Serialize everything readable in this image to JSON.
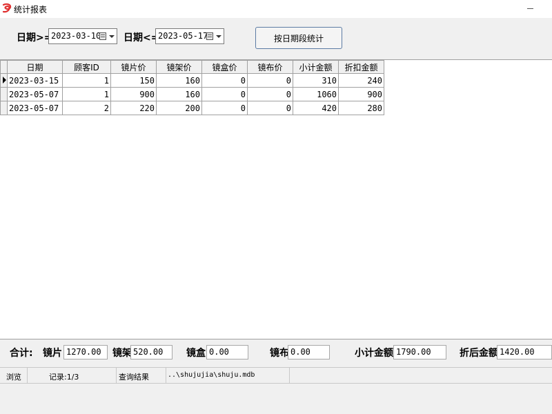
{
  "window": {
    "title": "统计报表"
  },
  "filter": {
    "date_from_label": "日期>=",
    "date_from_value": "2023-03-10",
    "date_to_label": "日期<=",
    "date_to_value": "2023-05-17",
    "stat_button_label": "按日期段统计"
  },
  "grid": {
    "columns": [
      "日期",
      "顾客ID",
      "镜片价",
      "镜架价",
      "镜盒价",
      "镜布价",
      "小计金额",
      "折扣金额"
    ],
    "rows": [
      [
        "2023-03-15",
        "1",
        "150",
        "160",
        "0",
        "0",
        "310",
        "240"
      ],
      [
        "2023-05-07",
        "1",
        "900",
        "160",
        "0",
        "0",
        "1060",
        "900"
      ],
      [
        "2023-05-07",
        "2",
        "220",
        "200",
        "0",
        "0",
        "420",
        "280"
      ]
    ],
    "current_row": 0
  },
  "totals": {
    "heading": "合计:",
    "lens_label": "镜片",
    "lens_value": "1270.00",
    "frame_label": "镜架",
    "frame_value": "520.00",
    "case_label": "镜盒",
    "case_value": "0.00",
    "cloth_label": "镜布",
    "cloth_value": "0.00",
    "subtotal_label": "小计金额",
    "subtotal_value": "1790.00",
    "discount_label": "折后金额",
    "discount_value": "1420.00"
  },
  "status": {
    "mode": "浏览",
    "record": "记录:1/3",
    "result": "查询结果",
    "db_path": "..\\shujujia\\shuju.mdb"
  },
  "colors": {
    "app_icon": "#e03030",
    "button_border": "#5b7ba3"
  }
}
